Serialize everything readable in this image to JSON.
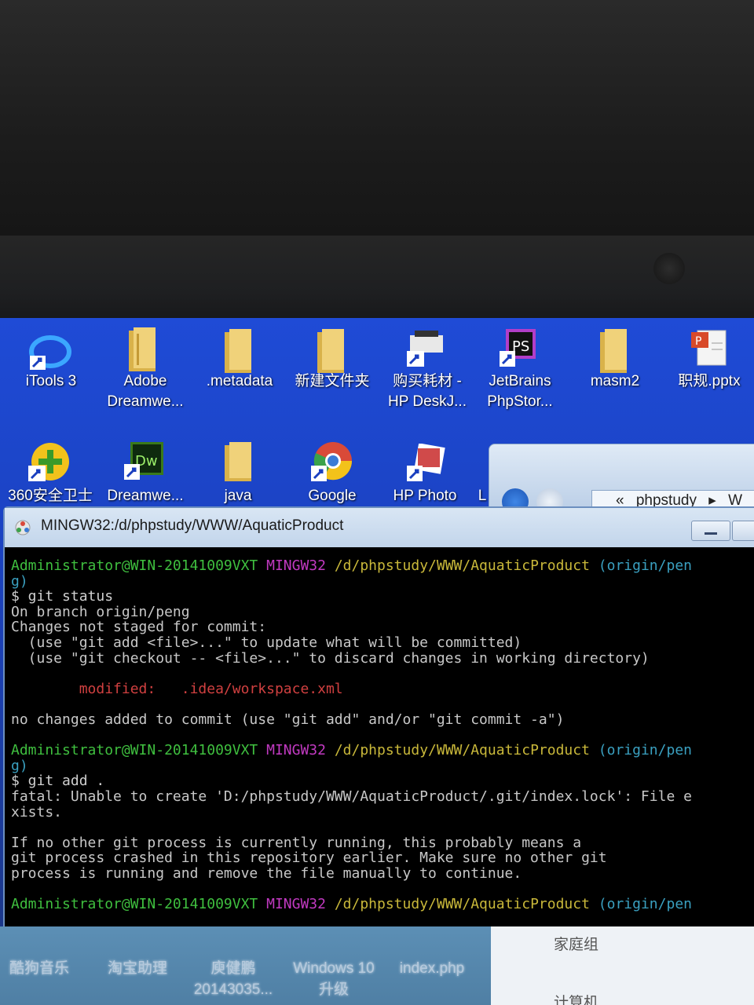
{
  "desktop": {
    "row1": [
      {
        "label1": "iTools 3",
        "label2": ""
      },
      {
        "label1": "Adobe",
        "label2": "Dreamwe..."
      },
      {
        "label1": ".metadata",
        "label2": ""
      },
      {
        "label1": "新建文件夹",
        "label2": ""
      },
      {
        "label1": "购买耗材 -",
        "label2": "HP DeskJ..."
      },
      {
        "label1": "JetBrains",
        "label2": "PhpStor..."
      },
      {
        "label1": "masm2",
        "label2": ""
      },
      {
        "label1": "职规.pptx",
        "label2": ""
      }
    ],
    "row2": [
      {
        "label1": "360安全卫士"
      },
      {
        "label1": "Dreamwe..."
      },
      {
        "label1": "java"
      },
      {
        "label1": "Google"
      },
      {
        "label1": "HP Photo"
      }
    ],
    "row2_cut_char": "L"
  },
  "explorer": {
    "address_prefix": "«",
    "address": "phpstudy",
    "address_tail": "W",
    "arrow": "▸"
  },
  "terminal": {
    "title": "MINGW32:/d/phpstudy/WWW/AquaticProduct",
    "prompt_user": "Administrator@WIN-20141009VXT",
    "prompt_sys": "MINGW32",
    "prompt_path": "/d/phpstudy/WWW/AquaticProduct",
    "prompt_branch": "(origin/pen",
    "prompt_wrap": "g)",
    "cmd1": "$ git status",
    "line_branch": "On branch origin/peng",
    "line_changes": "Changes not staged for commit:",
    "line_use1": "  (use \"git add <file>...\" to update what will be committed)",
    "line_use2": "  (use \"git checkout -- <file>...\" to discard changes in working directory)",
    "modified_label": "        modified:   .idea/workspace.xml",
    "line_nochanges": "no changes added to commit (use \"git add\" and/or \"git commit -a\")",
    "cmd2": "$ git add .",
    "fatal1": "fatal: Unable to create 'D:/phpstudy/WWW/AquaticProduct/.git/index.lock': File e",
    "fatal2": "xists.",
    "info1": "If no other git process is currently running, this probably means a",
    "info2": "git process crashed in this repository earlier. Make sure no other git",
    "info3": "process is running and remove the file manually to continue."
  },
  "taskbar": {
    "items": [
      {
        "label1": "酷狗音乐",
        "label2": ""
      },
      {
        "label1": "淘宝助理",
        "label2": ""
      },
      {
        "label1": "庾健鹏",
        "label2": "20143035..."
      },
      {
        "label1": "Windows 10",
        "label2": "升级"
      },
      {
        "label1": "index.php",
        "label2": ""
      }
    ],
    "side": {
      "item1": "家庭组",
      "item2": "计算机"
    }
  },
  "colors": {
    "desktop_blue": "#1f4bd6",
    "term_bg": "#000000",
    "prompt_green": "#3fbf3f",
    "prompt_magenta": "#c23ac2",
    "prompt_yellow": "#c9b83a",
    "prompt_cyan": "#3aa0c0",
    "error_red": "#d04040"
  }
}
